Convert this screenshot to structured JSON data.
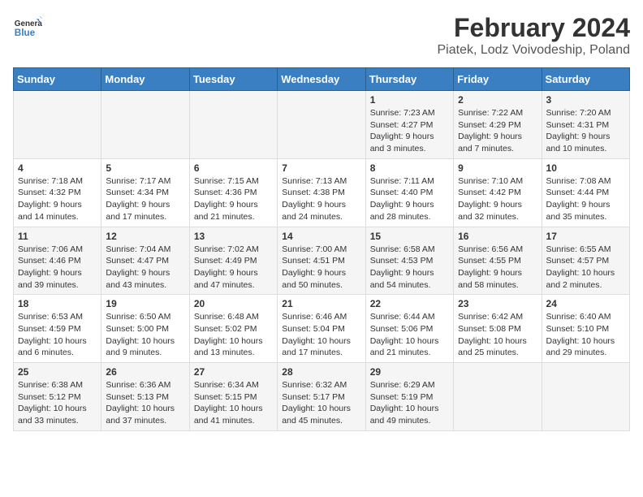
{
  "header": {
    "logo_line1": "General",
    "logo_line2": "Blue",
    "title": "February 2024",
    "subtitle": "Piatek, Lodz Voivodeship, Poland"
  },
  "days_of_week": [
    "Sunday",
    "Monday",
    "Tuesday",
    "Wednesday",
    "Thursday",
    "Friday",
    "Saturday"
  ],
  "weeks": [
    [
      {
        "day": "",
        "content": ""
      },
      {
        "day": "",
        "content": ""
      },
      {
        "day": "",
        "content": ""
      },
      {
        "day": "",
        "content": ""
      },
      {
        "day": "1",
        "content": "Sunrise: 7:23 AM\nSunset: 4:27 PM\nDaylight: 9 hours\nand 3 minutes."
      },
      {
        "day": "2",
        "content": "Sunrise: 7:22 AM\nSunset: 4:29 PM\nDaylight: 9 hours\nand 7 minutes."
      },
      {
        "day": "3",
        "content": "Sunrise: 7:20 AM\nSunset: 4:31 PM\nDaylight: 9 hours\nand 10 minutes."
      }
    ],
    [
      {
        "day": "4",
        "content": "Sunrise: 7:18 AM\nSunset: 4:32 PM\nDaylight: 9 hours\nand 14 minutes."
      },
      {
        "day": "5",
        "content": "Sunrise: 7:17 AM\nSunset: 4:34 PM\nDaylight: 9 hours\nand 17 minutes."
      },
      {
        "day": "6",
        "content": "Sunrise: 7:15 AM\nSunset: 4:36 PM\nDaylight: 9 hours\nand 21 minutes."
      },
      {
        "day": "7",
        "content": "Sunrise: 7:13 AM\nSunset: 4:38 PM\nDaylight: 9 hours\nand 24 minutes."
      },
      {
        "day": "8",
        "content": "Sunrise: 7:11 AM\nSunset: 4:40 PM\nDaylight: 9 hours\nand 28 minutes."
      },
      {
        "day": "9",
        "content": "Sunrise: 7:10 AM\nSunset: 4:42 PM\nDaylight: 9 hours\nand 32 minutes."
      },
      {
        "day": "10",
        "content": "Sunrise: 7:08 AM\nSunset: 4:44 PM\nDaylight: 9 hours\nand 35 minutes."
      }
    ],
    [
      {
        "day": "11",
        "content": "Sunrise: 7:06 AM\nSunset: 4:46 PM\nDaylight: 9 hours\nand 39 minutes."
      },
      {
        "day": "12",
        "content": "Sunrise: 7:04 AM\nSunset: 4:47 PM\nDaylight: 9 hours\nand 43 minutes."
      },
      {
        "day": "13",
        "content": "Sunrise: 7:02 AM\nSunset: 4:49 PM\nDaylight: 9 hours\nand 47 minutes."
      },
      {
        "day": "14",
        "content": "Sunrise: 7:00 AM\nSunset: 4:51 PM\nDaylight: 9 hours\nand 50 minutes."
      },
      {
        "day": "15",
        "content": "Sunrise: 6:58 AM\nSunset: 4:53 PM\nDaylight: 9 hours\nand 54 minutes."
      },
      {
        "day": "16",
        "content": "Sunrise: 6:56 AM\nSunset: 4:55 PM\nDaylight: 9 hours\nand 58 minutes."
      },
      {
        "day": "17",
        "content": "Sunrise: 6:55 AM\nSunset: 4:57 PM\nDaylight: 10 hours\nand 2 minutes."
      }
    ],
    [
      {
        "day": "18",
        "content": "Sunrise: 6:53 AM\nSunset: 4:59 PM\nDaylight: 10 hours\nand 6 minutes."
      },
      {
        "day": "19",
        "content": "Sunrise: 6:50 AM\nSunset: 5:00 PM\nDaylight: 10 hours\nand 9 minutes."
      },
      {
        "day": "20",
        "content": "Sunrise: 6:48 AM\nSunset: 5:02 PM\nDaylight: 10 hours\nand 13 minutes."
      },
      {
        "day": "21",
        "content": "Sunrise: 6:46 AM\nSunset: 5:04 PM\nDaylight: 10 hours\nand 17 minutes."
      },
      {
        "day": "22",
        "content": "Sunrise: 6:44 AM\nSunset: 5:06 PM\nDaylight: 10 hours\nand 21 minutes."
      },
      {
        "day": "23",
        "content": "Sunrise: 6:42 AM\nSunset: 5:08 PM\nDaylight: 10 hours\nand 25 minutes."
      },
      {
        "day": "24",
        "content": "Sunrise: 6:40 AM\nSunset: 5:10 PM\nDaylight: 10 hours\nand 29 minutes."
      }
    ],
    [
      {
        "day": "25",
        "content": "Sunrise: 6:38 AM\nSunset: 5:12 PM\nDaylight: 10 hours\nand 33 minutes."
      },
      {
        "day": "26",
        "content": "Sunrise: 6:36 AM\nSunset: 5:13 PM\nDaylight: 10 hours\nand 37 minutes."
      },
      {
        "day": "27",
        "content": "Sunrise: 6:34 AM\nSunset: 5:15 PM\nDaylight: 10 hours\nand 41 minutes."
      },
      {
        "day": "28",
        "content": "Sunrise: 6:32 AM\nSunset: 5:17 PM\nDaylight: 10 hours\nand 45 minutes."
      },
      {
        "day": "29",
        "content": "Sunrise: 6:29 AM\nSunset: 5:19 PM\nDaylight: 10 hours\nand 49 minutes."
      },
      {
        "day": "",
        "content": ""
      },
      {
        "day": "",
        "content": ""
      }
    ]
  ]
}
